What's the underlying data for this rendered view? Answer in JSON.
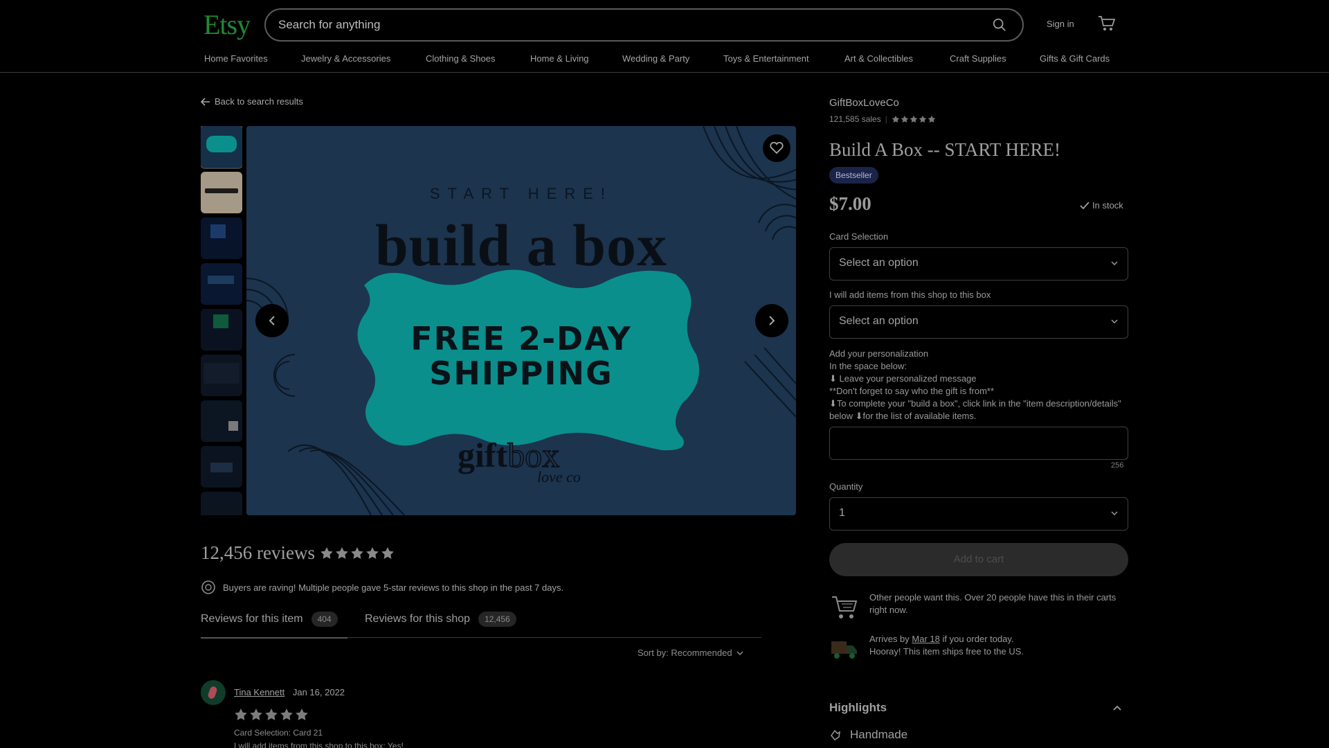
{
  "header": {
    "logo": "Etsy",
    "search_placeholder": "Search for anything",
    "sign_in": "Sign in",
    "categories": [
      "Home Favorites",
      "Jewelry & Accessories",
      "Clothing & Shoes",
      "Home & Living",
      "Wedding & Party",
      "Toys & Entertainment",
      "Art & Collectibles",
      "Craft Supplies",
      "Gifts & Gift Cards"
    ]
  },
  "listing": {
    "back_link": "Back to search results",
    "image": {
      "start_here": "START HERE!",
      "headline": "build a box",
      "shipping_line1": "FREE 2-DAY",
      "shipping_line2": "SHIPPING",
      "brand_bold": "gift",
      "brand_outline": "box",
      "brand_sub": "love co"
    },
    "shop_name": "GiftBoxLoveCo",
    "sales": "121,585 sales",
    "title": "Build A Box -- START HERE!",
    "badge": "Bestseller",
    "price": "$7.00",
    "stock": "In stock",
    "card_selection_label": "Card Selection",
    "card_selection_value": "Select an option",
    "add_items_label": "I will add items from this shop to this box",
    "add_items_value": "Select an option",
    "personalization": {
      "line1": "Add your personalization",
      "line2": "In the space below:",
      "line3": "⬇ Leave your personalized message",
      "line4": "**Don't forget to say who the gift is from**",
      "line5": "⬇To complete your \"build a box\", click link in the \"item description/details\" below ⬇for the list of available items."
    },
    "char_counter": "256",
    "quantity_label": "Quantity",
    "quantity_value": "1",
    "add_to_cart": "Add to cart",
    "demand_text": "Other people want this. Over 20 people have this in their carts right now.",
    "arrives_prefix": "Arrives by ",
    "arrives_date": "Mar 18",
    "arrives_suffix": " if you order today.",
    "free_ship": "Hooray! This item ships free to the US.",
    "highlights": "Highlights",
    "handmade": "Handmade"
  },
  "reviews": {
    "count_title": "12,456 reviews",
    "raving": "Buyers are raving! Multiple people gave 5-star reviews to this shop in the past 7 days.",
    "tab_item": "Reviews for this item",
    "tab_item_count": "404",
    "tab_shop": "Reviews for this shop",
    "tab_shop_count": "12,456",
    "sort": "Sort by: Recommended",
    "reviewer_name": "Tina Kennett",
    "review_date": "Jan 16, 2022",
    "review_line1": "Card Selection: Card 21",
    "review_line2": "I will add items from this shop to this box: Yes!"
  },
  "colors": {
    "brand": "#1f8a35",
    "image_bg": "#1c344e",
    "teal": "#0a8f8c"
  }
}
